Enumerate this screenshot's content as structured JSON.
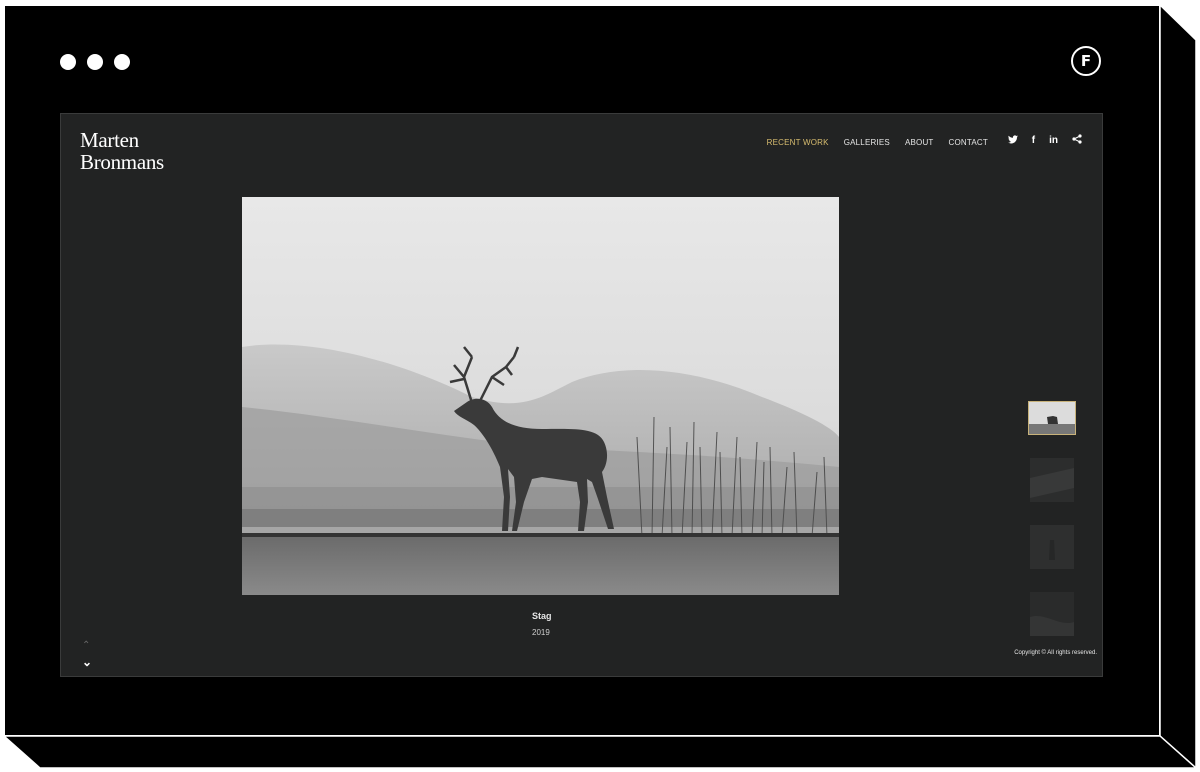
{
  "window": {
    "brand_badge": "F"
  },
  "site": {
    "logo_line1": "Marten",
    "logo_line2": "Bronmans",
    "nav": [
      {
        "label": "RECENT WORK",
        "active": true
      },
      {
        "label": "GALLERIES",
        "active": false
      },
      {
        "label": "ABOUT",
        "active": false
      },
      {
        "label": "CONTACT",
        "active": false
      }
    ],
    "social_icons": [
      "twitter-icon",
      "facebook-icon",
      "linkedin-icon",
      "share-icon"
    ],
    "social_glyphs": {
      "twitter": "🐦",
      "facebook": "f",
      "linkedin": "in",
      "share": "<"
    },
    "photo": {
      "title": "Stag",
      "year": "2019"
    },
    "copyright": "Copyright © All rights reserved.",
    "accent_color": "#d8bd70"
  }
}
